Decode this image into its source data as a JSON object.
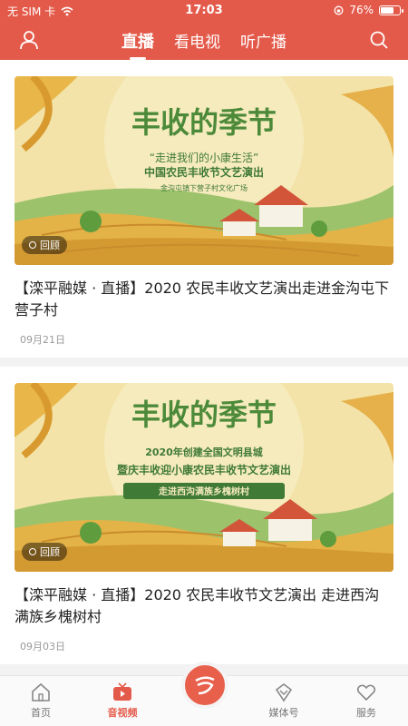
{
  "status": {
    "carrier": "无 SIM 卡",
    "time": "17:03",
    "battery": "76%",
    "battery_level": 0.76
  },
  "header": {
    "tabs": [
      {
        "label": "直播",
        "active": true
      },
      {
        "label": "看电视",
        "active": false
      },
      {
        "label": "听广播",
        "active": false
      }
    ],
    "accent": "#e45a4a"
  },
  "feed": [
    {
      "badge": "回顾",
      "title": "【滦平融媒 · 直播】2020 农民丰收文艺演出走进金沟屯下营子村",
      "date": "09月21日",
      "poster": {
        "headline": "丰收的季节",
        "line1": "“走进我们的小康生活”",
        "line2": "中国农民丰收节文艺演出",
        "line3": "金沟屯镇下营子村文化广场"
      }
    },
    {
      "badge": "回顾",
      "title": "【滦平融媒 · 直播】2020 农民丰收节文艺演出 走进西沟满族乡槐树村",
      "date": "09月03日",
      "poster": {
        "headline": "丰收的季节",
        "line1": "2020年创建全国文明县城",
        "line2": "暨庆丰收迎小康农民丰收节文艺演出",
        "line3": "走进西沟满族乡槐树村"
      }
    }
  ],
  "bottom_nav": [
    {
      "label": "首页",
      "icon": "home-icon",
      "active": false
    },
    {
      "label": "音视频",
      "icon": "tv-icon",
      "active": true
    },
    {
      "label": "",
      "icon": "center-logo-icon",
      "active": false
    },
    {
      "label": "媒体号",
      "icon": "diamond-icon",
      "active": false
    },
    {
      "label": "服务",
      "icon": "heart-icon",
      "active": false
    }
  ]
}
